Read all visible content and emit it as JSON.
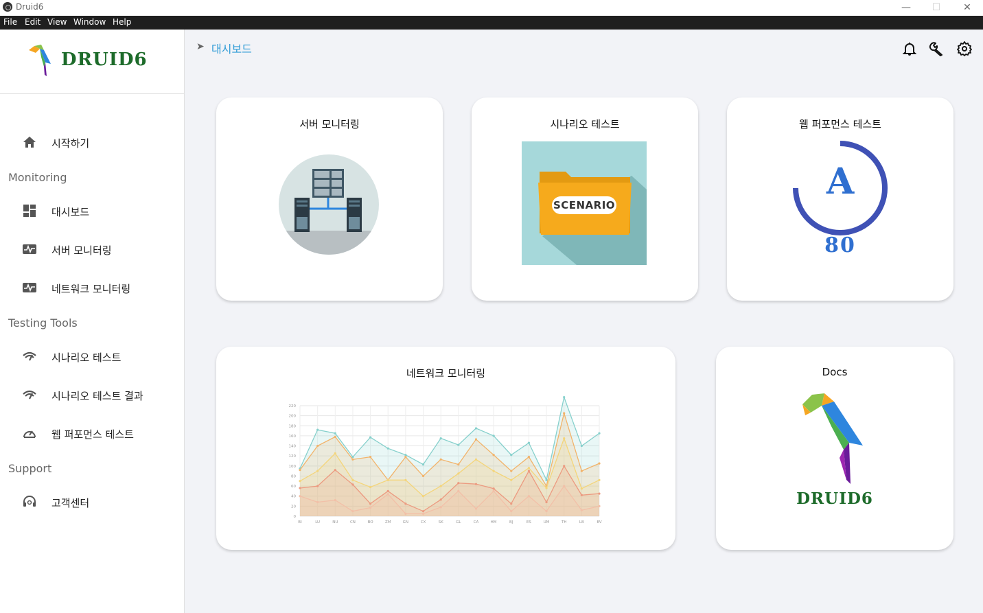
{
  "window": {
    "title": "Druid6"
  },
  "menu": [
    "File",
    "Edit",
    "View",
    "Window",
    "Help"
  ],
  "brand": {
    "name": "Druid6",
    "logo_text": "DRUID6"
  },
  "sidebar": {
    "home": "시작하기",
    "sections": {
      "monitoring": "Monitoring",
      "testing": "Testing Tools",
      "support": "Support"
    },
    "items": {
      "dashboard": "대시보드",
      "server": "서버 모니터링",
      "network": "네트워크 모니터링",
      "scenario": "시나리오 테스트",
      "scenario_result": "시나리오 테스트 결과",
      "webperf": "웹 퍼포먼스 테스트",
      "support": "고객센터"
    }
  },
  "breadcrumb": {
    "current": "대시보드"
  },
  "header_icons": [
    "bell-icon",
    "wrench-icon",
    "gear-icon"
  ],
  "cards": {
    "server": "서버 모니터링",
    "scenario": "시나리오 테스트",
    "scenario_label": "SCENARIO",
    "webperf": "웹 퍼포먼스 테스트",
    "webperf_grade": "A",
    "webperf_score": "80",
    "network": "네트워크 모니터링",
    "docs": "Docs"
  },
  "colors": {
    "accent": "#2e9bd6",
    "brand_green": "#1d6b2a",
    "gauge": "#3f51b5"
  },
  "chart_data": {
    "type": "area",
    "categories": [
      "BI",
      "LU",
      "NU",
      "CN",
      "BO",
      "ZM",
      "GN",
      "CX",
      "SK",
      "GL",
      "CA",
      "HM",
      "BJ",
      "ES",
      "UM",
      "TH",
      "LB",
      "BV"
    ],
    "ylim": [
      0,
      220
    ],
    "yticks": [
      0,
      20,
      40,
      60,
      80,
      100,
      120,
      140,
      160,
      180,
      200,
      220
    ],
    "series": [
      {
        "color": "#86d0cc",
        "values": [
          95,
          172,
          165,
          118,
          157,
          135,
          122,
          103,
          155,
          142,
          175,
          160,
          122,
          146,
          72,
          237,
          140,
          165
        ]
      },
      {
        "color": "#f2b36a",
        "values": [
          92,
          140,
          158,
          113,
          118,
          72,
          118,
          80,
          113,
          103,
          153,
          122,
          90,
          118,
          60,
          205,
          90,
          105
        ]
      },
      {
        "color": "#f4d57a",
        "values": [
          70,
          90,
          125,
          72,
          58,
          72,
          72,
          40,
          60,
          85,
          113,
          90,
          72,
          96,
          56,
          155,
          55,
          72
        ]
      },
      {
        "color": "#ec9a80",
        "values": [
          56,
          60,
          92,
          63,
          25,
          50,
          25,
          10,
          33,
          66,
          64,
          55,
          25,
          90,
          28,
          100,
          42,
          45
        ]
      },
      {
        "color": "#f2c0a8",
        "values": [
          40,
          28,
          32,
          10,
          17,
          44,
          5,
          5,
          18,
          50,
          15,
          50,
          10,
          40,
          10,
          60,
          12,
          20
        ]
      }
    ]
  }
}
